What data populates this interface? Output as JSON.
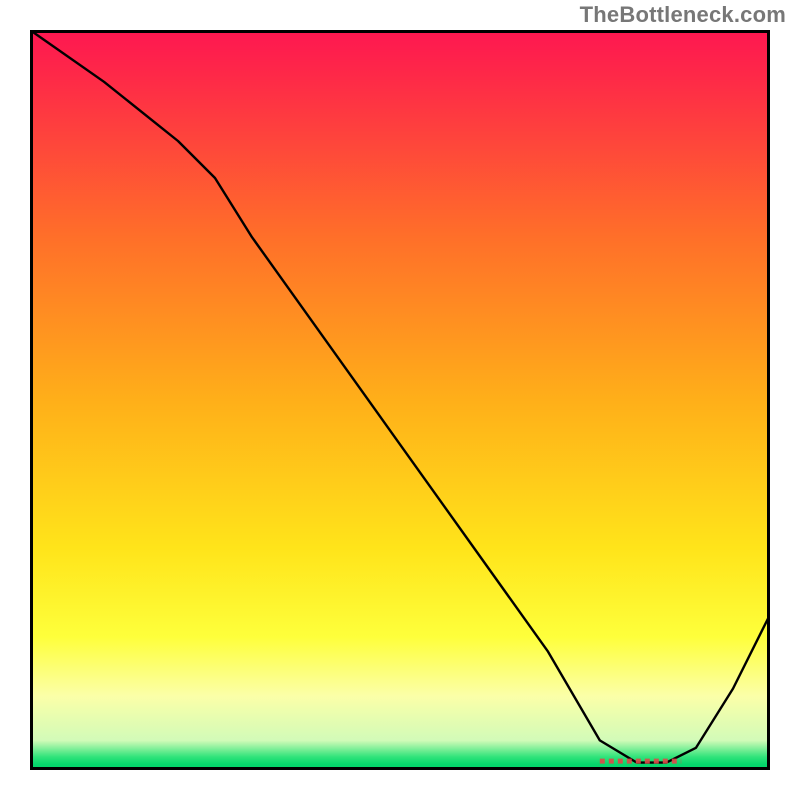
{
  "watermark": "TheBottleneck.com",
  "chart_data": {
    "type": "line",
    "title": "",
    "xlabel": "",
    "ylabel": "",
    "xlim": [
      0,
      100
    ],
    "ylim": [
      0,
      100
    ],
    "x": [
      0,
      10,
      20,
      25,
      30,
      40,
      50,
      60,
      70,
      77,
      82,
      86,
      90,
      95,
      100
    ],
    "values": [
      100,
      93,
      85,
      80,
      72,
      58,
      44,
      30,
      16,
      4,
      1,
      1,
      3,
      11,
      21
    ],
    "optimum_band": {
      "x_start": 77,
      "x_end": 88,
      "y": 1.2
    },
    "gradient_stops": [
      {
        "pos": 0.0,
        "color": "#fe1751"
      },
      {
        "pos": 0.06,
        "color": "#fe2848"
      },
      {
        "pos": 0.28,
        "color": "#ff6f29"
      },
      {
        "pos": 0.5,
        "color": "#ffaf19"
      },
      {
        "pos": 0.7,
        "color": "#ffe41a"
      },
      {
        "pos": 0.82,
        "color": "#feff3b"
      },
      {
        "pos": 0.9,
        "color": "#fbffa8"
      },
      {
        "pos": 0.96,
        "color": "#d2fbb8"
      },
      {
        "pos": 0.985,
        "color": "#32e47b"
      },
      {
        "pos": 1.0,
        "color": "#03d46a"
      }
    ]
  }
}
